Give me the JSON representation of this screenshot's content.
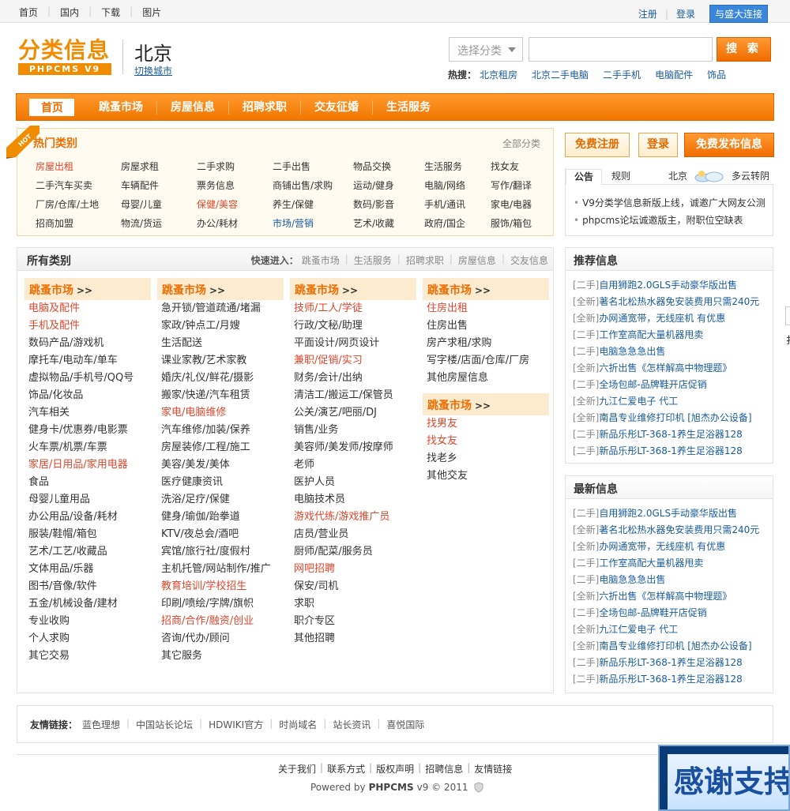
{
  "topbar": {
    "links": [
      "首页",
      "国内",
      "下载",
      "图片"
    ],
    "register": "注册",
    "login": "登录",
    "connect": "与盛大连接"
  },
  "header": {
    "logo_main": "分类信息",
    "logo_sub": "PHPCMS V9",
    "city": "北京",
    "switch_city": "切换城市",
    "search_category_placeholder": "选择分类",
    "search_button": "搜 索",
    "hot_label": "热搜：",
    "hot_links": [
      "北京租房",
      "北京二手电脑",
      "二手手机",
      "电脑配件",
      "饰品"
    ]
  },
  "nav": {
    "items": [
      "首页",
      "跳蚤市场",
      "房屋信息",
      "招聘求职",
      "交友征婚",
      "生活服务"
    ]
  },
  "hot_categories": {
    "ribbon": "HOT",
    "title": "热门类别",
    "all_link": "全部分类",
    "rows": [
      [
        "房屋出租",
        "房屋求租",
        "二手求购",
        "二手出售",
        "物品交换",
        "生活服务",
        "找女友"
      ],
      [
        "二手汽车买卖",
        "车辆配件",
        "票务信息",
        "商铺出售/求购",
        "运动/健身",
        "电脑/网络",
        "写作/翻译"
      ],
      [
        "厂房/仓库/土地",
        "母婴/儿童",
        "保健/美容",
        "养生/保健",
        "数码/影音",
        "手机/通讯",
        "家电/电器"
      ],
      [
        "招商加盟",
        "物流/货运",
        "办公/耗材",
        "市场/营销",
        "艺术/收藏",
        "政府/国企",
        "服饰/箱包"
      ]
    ]
  },
  "right_buttons": {
    "register": "免费注册",
    "login": "登录",
    "publish": "免费发布信息"
  },
  "notice": {
    "tab_active": "公告",
    "tab_other": "规则",
    "weather_city": "北京",
    "weather_text": "多云转阴",
    "items": [
      "V9分类学信息新版上线，诚邀广大网友公测",
      "phpcms论坛诚邀版主，附职位空缺表"
    ]
  },
  "all_categories": {
    "title": "所有类别",
    "quick_label": "快速进入：",
    "quick_links": [
      "跳蚤市场",
      "生活服务",
      "招聘求职",
      "房屋信息",
      "交友信息"
    ],
    "columns": [
      {
        "head": "跳蚤市场",
        "items": [
          "电脑及配件",
          "手机及配件",
          "数码产品/游戏机",
          "摩托车/电动车/单车",
          "虚拟物品/手机号/QQ号",
          "饰品/化妆品",
          "汽车相关",
          "健身卡/优惠券/电影票",
          "火车票/机票/车票",
          "家居/日用品/家用电器",
          "食品",
          "母婴儿童用品",
          "办公用品/设备/耗材",
          "服装/鞋帽/箱包",
          "艺术/工艺/收藏品",
          "文体用品/乐器",
          "图书/音像/软件",
          "五金/机械设备/建材",
          "专业收购",
          "个人求购",
          "其它交易"
        ]
      },
      {
        "head": "跳蚤市场",
        "items": [
          "急开锁/管道疏通/堵漏",
          "家政/钟点工/月嫂",
          "生活配送",
          "课业家教/艺术家教",
          "婚庆/礼仪/鲜花/摄影",
          "搬家/快递/汽车租赁",
          "家电/电脑维修",
          "汽车维修/加装/保养",
          "房屋装修/工程/施工",
          "美容/美发/美体",
          "医疗健康资讯",
          "洗浴/足疗/保健",
          "健身/瑜伽/跆拳道",
          "KTV/夜总会/酒吧",
          "宾馆/旅行社/度假村",
          "主机托管/网站制作/推广",
          "教育培训/学校招生",
          "印刷/喷绘/字牌/旗帜",
          "招商/合作/融资/创业",
          "咨询/代办/顾问",
          "其它服务"
        ]
      },
      {
        "head": "跳蚤市场",
        "items": [
          "技师/工人/学徒",
          "行政/文秘/助理",
          "平面设计/网页设计",
          "兼职/促销/实习",
          "财务/会计/出纳",
          "清洁工/搬运工/保管员",
          "公关/演艺/吧丽/DJ",
          "销售/业务",
          "美容师/美发师/按摩师",
          "老师",
          "医护人员",
          "电脑技术员",
          "游戏代练/游戏推广员",
          "店员/营业员",
          "厨师/配菜/服务员",
          "网吧招聘",
          "保安/司机",
          "求职",
          "职介专区",
          "其他招聘"
        ]
      },
      {
        "head": "跳蚤市场",
        "items": [
          "住房出租",
          "住房出售",
          "房产求租/求购",
          "写字楼/店面/仓库/厂房",
          "其他房屋信息"
        ]
      },
      {
        "head": "跳蚤市场",
        "items": [
          "找男友",
          "找女友",
          "找老乡",
          "其他交友"
        ]
      }
    ]
  },
  "recommended": {
    "title": "推荐信息",
    "items": [
      {
        "tag": "[二手]",
        "text": "自用狮跑2.0GLS手动豪华版出售"
      },
      {
        "tag": "[全新]",
        "text": "著名北松热水器免安装费用只需240元"
      },
      {
        "tag": "[全新]",
        "text": "办网通宽带，无线座机 有优惠"
      },
      {
        "tag": "[二手]",
        "text": "工作室高配大量机器甩卖"
      },
      {
        "tag": "[二手]",
        "text": "电脑急急急出售"
      },
      {
        "tag": "[全新]",
        "text": "六折出售《怎样解高中物理题》"
      },
      {
        "tag": "[二手]",
        "text": "全场包邮-品牌鞋开店促销"
      },
      {
        "tag": "[全新]",
        "text": "九江仁爱电子 代工"
      },
      {
        "tag": "[全新]",
        "text": "南昌专业维修打印机 [旭杰办公设备]"
      },
      {
        "tag": "[二手]",
        "text": "新品乐彤LT-368-1养生足浴器128"
      },
      {
        "tag": "[二手]",
        "text": "新品乐彤LT-368-1养生足浴器128"
      }
    ]
  },
  "latest": {
    "title": "最新信息",
    "items": [
      {
        "tag": "[二手]",
        "text": "自用狮跑2.0GLS手动豪华版出售"
      },
      {
        "tag": "[全新]",
        "text": "著名北松热水器免安装费用只需240元"
      },
      {
        "tag": "[全新]",
        "text": "办网通宽带，无线座机 有优惠"
      },
      {
        "tag": "[二手]",
        "text": "工作室高配大量机器甩卖"
      },
      {
        "tag": "[二手]",
        "text": "电脑急急急出售"
      },
      {
        "tag": "[全新]",
        "text": "六折出售《怎样解高中物理题》"
      },
      {
        "tag": "[二手]",
        "text": "全场包邮-品牌鞋开店促销"
      },
      {
        "tag": "[全新]",
        "text": "九江仁爱电子 代工"
      },
      {
        "tag": "[全新]",
        "text": "南昌专业维修打印机 [旭杰办公设备]"
      },
      {
        "tag": "[二手]",
        "text": "新品乐彤LT-368-1养生足浴器128"
      },
      {
        "tag": "[二手]",
        "text": "新品乐彤LT-368-1养生足浴器128"
      }
    ]
  },
  "friend_links": {
    "label": "友情链接：",
    "items": [
      "蓝色理想",
      "中国站长论坛",
      "HDWIKI官方",
      "时尚域名",
      "站长资讯",
      "喜悦国际"
    ]
  },
  "footer": {
    "links": [
      "关于我们",
      "联系方式",
      "版权声明",
      "招聘信息",
      "友情链接"
    ],
    "powered_prefix": "Powered by",
    "powered_brand": "PHPCMS",
    "powered_suffix": "v9 © 2011"
  },
  "overlay": {
    "thanks": "感谢支持"
  },
  "edge_text": "扌",
  "colors": {
    "accent": "#f06d00",
    "link": "#1a5b9a",
    "highlight": "#e0462c"
  }
}
